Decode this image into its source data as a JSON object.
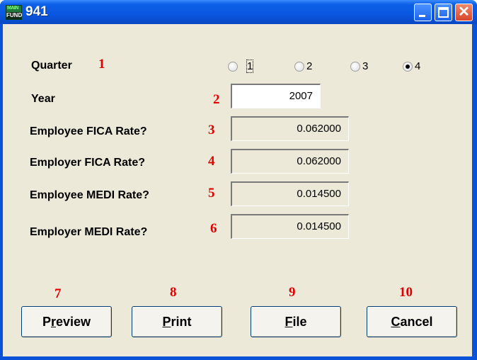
{
  "window": {
    "title": "941",
    "icon_text_top": "MAIN",
    "icon_text_bottom": "FUND",
    "controls": [
      "minimize-icon",
      "maximize-icon",
      "close-icon"
    ],
    "close_glyph": "✕"
  },
  "quarter": {
    "label": "Quarter",
    "callout": "1",
    "options": [
      "1",
      "2",
      "3",
      "4"
    ],
    "selected": "4"
  },
  "year": {
    "label": "Year",
    "callout": "2",
    "value": "2007"
  },
  "employee_fica": {
    "label": "Employee FICA Rate?",
    "callout": "3",
    "value": "0.062000"
  },
  "employer_fica": {
    "label": "Employer FICA Rate?",
    "callout": "4",
    "value": "0.062000"
  },
  "employee_medi": {
    "label": "Employee MEDI Rate?",
    "callout": "5",
    "value": "0.014500"
  },
  "employer_medi": {
    "label": "Employer MEDI Rate?",
    "callout": "6",
    "value": "0.014500"
  },
  "buttons": {
    "preview": {
      "callout": "7",
      "pre": "P",
      "accel": "r",
      "post": "eview"
    },
    "print": {
      "callout": "8",
      "pre": "",
      "accel": "P",
      "post": "rint"
    },
    "file": {
      "callout": "9",
      "pre": "",
      "accel": "F",
      "post": "ile"
    },
    "cancel": {
      "callout": "10",
      "pre": "",
      "accel": "C",
      "post": "ancel"
    }
  },
  "colors": {
    "titlebar": "#0a56df",
    "client": "#ece9d8",
    "callout": "#e00000",
    "button_border": "#003c74"
  }
}
